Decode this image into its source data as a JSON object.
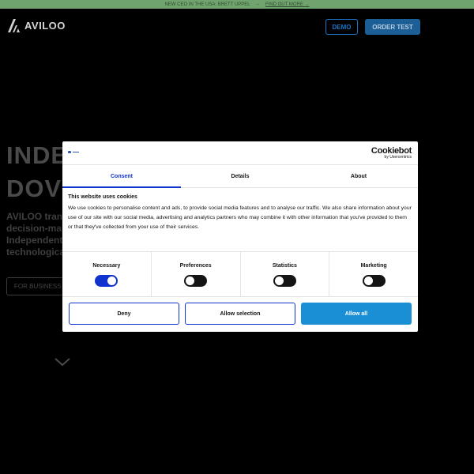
{
  "announcement": {
    "text": "NEW CEO IN THE USA: BRETT UPPEL",
    "separator": "–",
    "link": "FIND OUT MORE →"
  },
  "header": {
    "logo": "AVILOO",
    "nav": [
      "",
      "",
      ""
    ],
    "demo_label": "DEMO",
    "order_label": "ORDER TEST",
    "lang": ""
  },
  "hero": {
    "line1": "INDE",
    "line2": "DOV",
    "p1": "AVILOO tran",
    "p2": "decision-ma",
    "p3": "Independent",
    "p4": "technologica",
    "cta": "FOR BUSINESS"
  },
  "cookie_dialog": {
    "brand_name": "Cookiebot",
    "brand_sub": "by Usercentrics",
    "tabs": [
      "Consent",
      "Details",
      "About"
    ],
    "title": "This website uses cookies",
    "description": "We use cookies to personalise content and ads, to provide social media features and to analyse our traffic. We also share information about your use of our site with our social media, advertising and analytics partners who may combine it with other information that you've provided to them or that they've collected from your use of their services.",
    "toggles": [
      {
        "label": "Necessary",
        "state": "on"
      },
      {
        "label": "Preferences",
        "state": "off"
      },
      {
        "label": "Statistics",
        "state": "off"
      },
      {
        "label": "Marketing",
        "state": "off"
      }
    ],
    "buttons": {
      "deny": "Deny",
      "allow_selection": "Allow selection",
      "allow_all": "Allow all"
    }
  },
  "colors": {
    "announcement_bg": "#6fa46e",
    "accent_blue": "#1032cf",
    "allow_all_bg": "#1a8fd6",
    "order_bg": "#1c5f96"
  }
}
